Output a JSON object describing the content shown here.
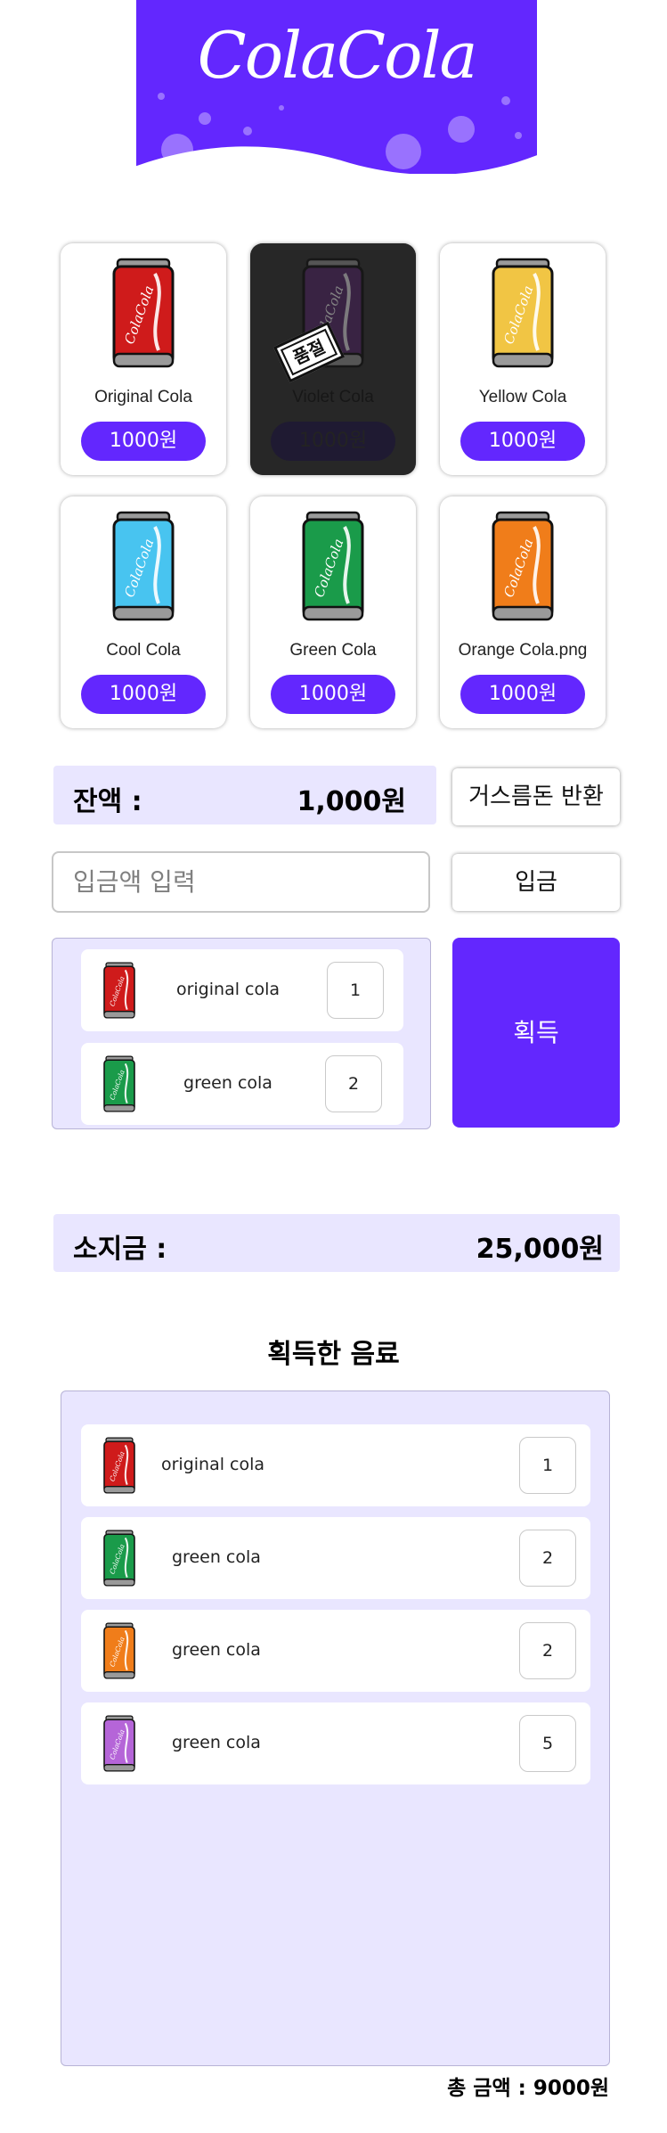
{
  "header": {
    "logo_text": "ColaCola"
  },
  "products": [
    {
      "name": "Original Cola",
      "price": "1000원",
      "color": "#cf1b1b",
      "sold_out": false
    },
    {
      "name": "Violet Cola",
      "price": "1000원",
      "color": "#5b2a72",
      "sold_out": true,
      "sold_label": "품절"
    },
    {
      "name": "Yellow Cola",
      "price": "1000원",
      "color": "#f1c544",
      "sold_out": false
    },
    {
      "name": "Cool Cola",
      "price": "1000원",
      "color": "#48c4f0",
      "sold_out": false
    },
    {
      "name": "Green Cola",
      "price": "1000원",
      "color": "#1a9b4a",
      "sold_out": false
    },
    {
      "name": "Orange Cola.png",
      "price": "1000원",
      "color": "#f07d1a",
      "sold_out": false
    }
  ],
  "balance": {
    "label": "잔액 :",
    "value": "1,000원"
  },
  "change_button": "거스름돈 반환",
  "deposit": {
    "placeholder": "입금액 입력",
    "button": "입금"
  },
  "cart": {
    "items": [
      {
        "name": "original cola",
        "qty": "1",
        "color": "#cf1b1b"
      },
      {
        "name": "green cola",
        "qty": "2",
        "color": "#1a9b4a"
      }
    ],
    "get_button": "획득"
  },
  "wallet": {
    "label": "소지금 :",
    "value": "25,000원"
  },
  "obtained": {
    "title": "획득한 음료",
    "items": [
      {
        "name": "original cola",
        "qty": "1",
        "color": "#cf1b1b"
      },
      {
        "name": "green cola",
        "qty": "2",
        "color": "#1a9b4a"
      },
      {
        "name": "green cola",
        "qty": "2",
        "color": "#f07d1a"
      },
      {
        "name": "green cola",
        "qty": "5",
        "color": "#b565d8"
      }
    ],
    "total": "총 금액 : 9000원"
  }
}
